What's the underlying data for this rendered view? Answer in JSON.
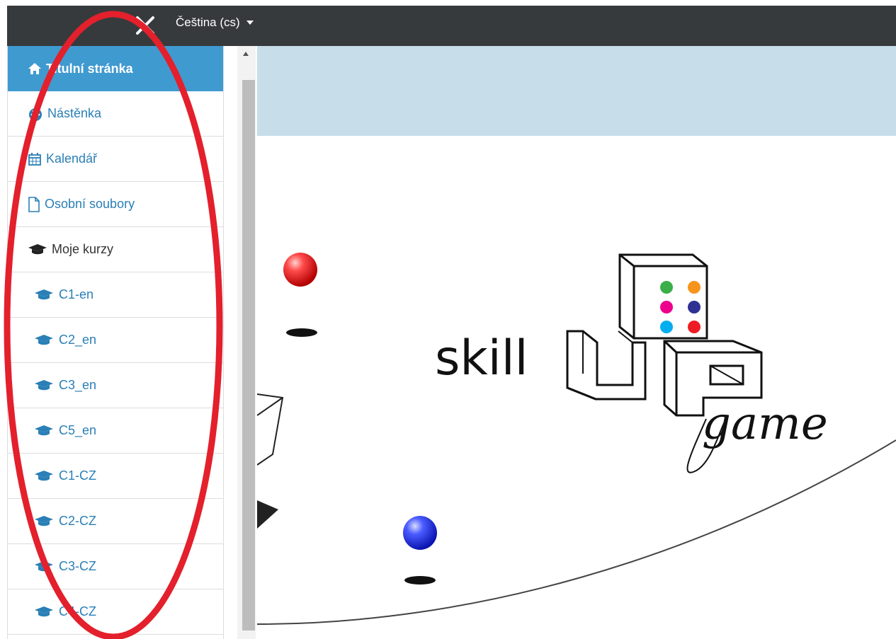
{
  "topbar": {
    "language_label": "Čeština (cs)"
  },
  "sidebar": {
    "items": [
      {
        "label": "Titulní stránka",
        "icon": "home-icon"
      },
      {
        "label": "Nástěnka",
        "icon": "dashboard-icon"
      },
      {
        "label": "Kalendář",
        "icon": "calendar-icon"
      },
      {
        "label": "Osobní soubory",
        "icon": "file-icon"
      },
      {
        "label": "Moje kurzy",
        "icon": "graduation-cap-icon"
      }
    ],
    "courses": [
      {
        "label": "C1-en"
      },
      {
        "label": "C2_en"
      },
      {
        "label": "C3_en"
      },
      {
        "label": "C5_en"
      },
      {
        "label": "C1-CZ"
      },
      {
        "label": "C2-CZ"
      },
      {
        "label": "C3-CZ"
      },
      {
        "label": "C4-CZ"
      }
    ]
  },
  "logo": {
    "word_left": "skill",
    "word_right": "game"
  },
  "colors": {
    "topbar": "#373a3c",
    "active_item": "#3f9ad0",
    "link": "#2a7fb6",
    "header_band": "#c7deea",
    "annotation": "#e3202c"
  }
}
